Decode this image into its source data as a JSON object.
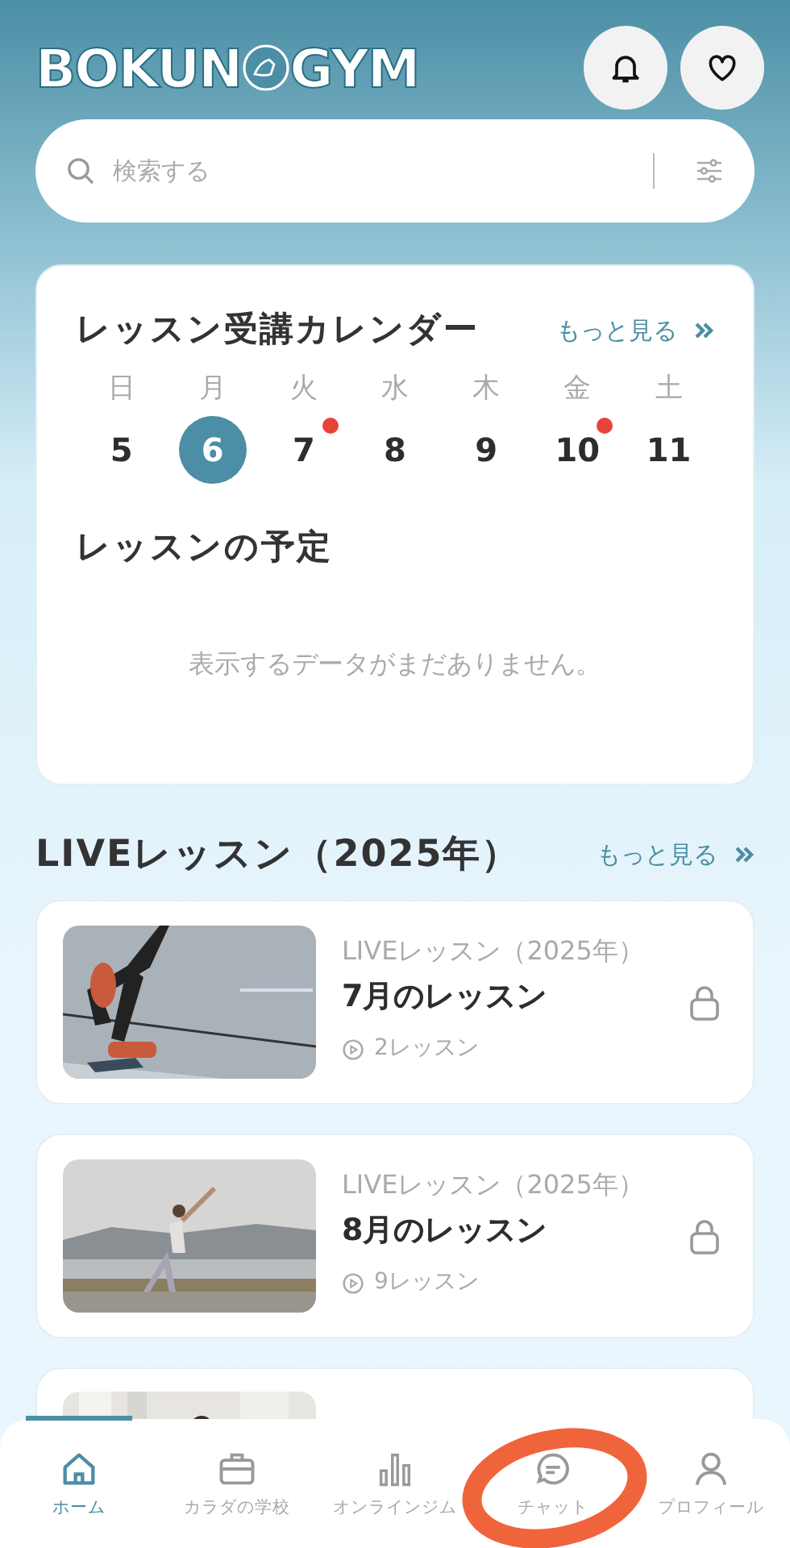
{
  "header": {
    "logo_left": "BOKUN",
    "logo_right": "GYM"
  },
  "search": {
    "placeholder": "検索する"
  },
  "calendar": {
    "title": "レッスン受講カレンダー",
    "more": "もっと見る",
    "days": [
      {
        "weekday": "日",
        "date": "5",
        "selected": false,
        "has_lesson": false
      },
      {
        "weekday": "月",
        "date": "6",
        "selected": true,
        "has_lesson": false
      },
      {
        "weekday": "火",
        "date": "7",
        "selected": false,
        "has_lesson": true
      },
      {
        "weekday": "水",
        "date": "8",
        "selected": false,
        "has_lesson": false
      },
      {
        "weekday": "木",
        "date": "9",
        "selected": false,
        "has_lesson": false
      },
      {
        "weekday": "金",
        "date": "10",
        "selected": false,
        "has_lesson": true
      },
      {
        "weekday": "土",
        "date": "11",
        "selected": false,
        "has_lesson": false
      }
    ],
    "schedule_title": "レッスンの予定",
    "empty_message": "表示するデータがまだありません。"
  },
  "live": {
    "title": "LIVEレッスン（2025年）",
    "more": "もっと見る",
    "items": [
      {
        "kind": "full",
        "category": "LIVEレッスン（2025年）",
        "title": "7月のレッスン",
        "count": "2レッスン",
        "locked": true
      },
      {
        "kind": "full",
        "category": "LIVEレッスン（2025年）",
        "title": "8月のレッスン",
        "count": "9レッスン",
        "locked": true
      },
      {
        "kind": "peek"
      }
    ]
  },
  "nav": [
    {
      "label": "ホーム",
      "selected": true,
      "circled": false
    },
    {
      "label": "カラダの学校",
      "selected": false,
      "circled": false
    },
    {
      "label": "オンラインジム",
      "selected": false,
      "circled": false
    },
    {
      "label": "チャット",
      "selected": false,
      "circled": true
    },
    {
      "label": "プロフィール",
      "selected": false,
      "circled": false
    }
  ]
}
